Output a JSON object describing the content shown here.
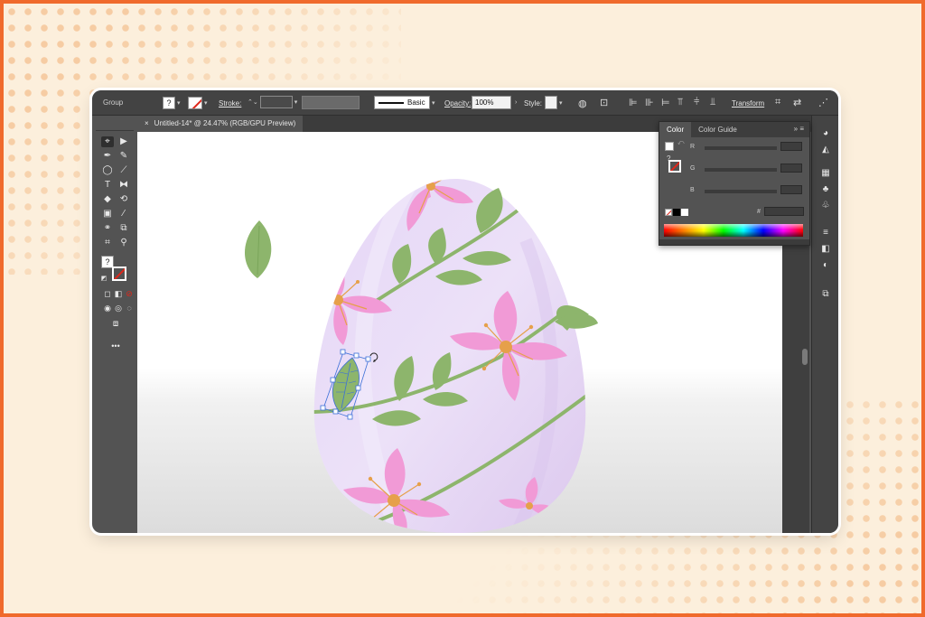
{
  "control_bar": {
    "selection_label": "Group",
    "stroke_label": "Stroke:",
    "brush_label": "Basic",
    "opacity_label": "Opacity:",
    "opacity_value": "100%",
    "style_label": "Style:",
    "transform_label": "Transform"
  },
  "document_tab": {
    "close_glyph": "×",
    "title": "Untitled-14* @ 24.47% (RGB/GPU Preview)"
  },
  "color_panel": {
    "tabs": [
      "Color",
      "Color Guide"
    ],
    "channels": [
      "R",
      "G",
      "B"
    ],
    "hex_symbol": "#",
    "menu_glyph": "»  ≡"
  },
  "toolbox": {
    "more_tools": "•••",
    "fill_question": "?"
  },
  "colors": {
    "accent_orange": "#f06a2c",
    "leaf_green": "#8db56c",
    "petal_pink": "#f19ad6",
    "egg_lavender": "#e9ddf6",
    "selection_blue": "#3b6fd8"
  }
}
